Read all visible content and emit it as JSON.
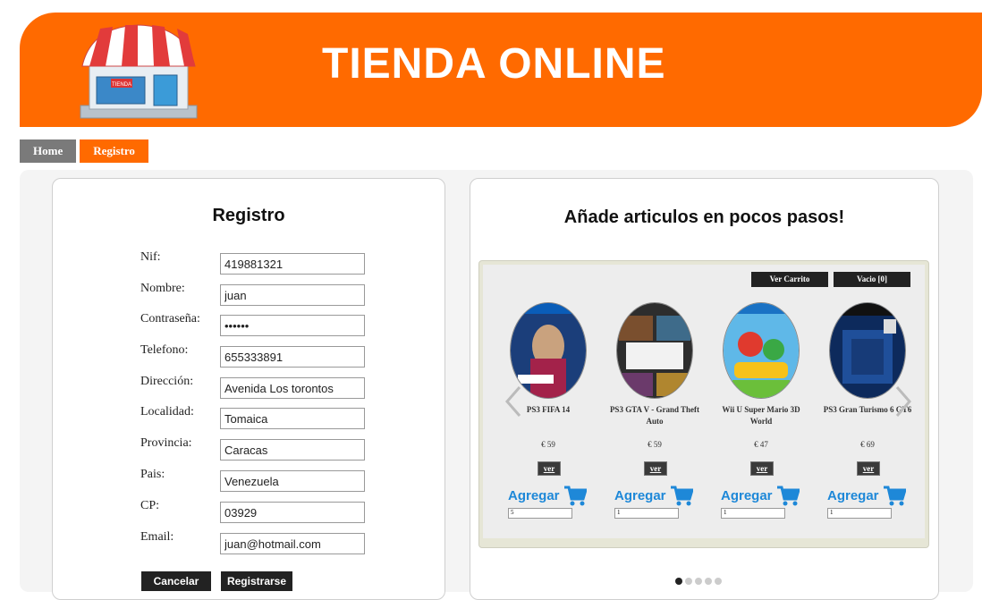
{
  "header": {
    "title": "TIENDA ONLINE",
    "logo_sign": "TIENDA"
  },
  "nav": {
    "home": "Home",
    "registro": "Registro"
  },
  "registro": {
    "title": "Registro",
    "fields": [
      {
        "label": "Nif:",
        "value": "419881321"
      },
      {
        "label": "Nombre:",
        "value": "juan"
      },
      {
        "label": "Contraseña:",
        "value": "••••••"
      },
      {
        "label": "Telefono:",
        "value": "655333891"
      },
      {
        "label": "Dirección:",
        "value": "Avenida Los torontos"
      },
      {
        "label": "Localidad:",
        "value": "Tomaica"
      },
      {
        "label": "Provincia:",
        "value": "Caracas"
      },
      {
        "label": "Pais:",
        "value": "Venezuela"
      },
      {
        "label": "CP:",
        "value": "03929"
      },
      {
        "label": "Email:",
        "value": "juan@hotmail.com"
      }
    ],
    "cancel": "Cancelar",
    "submit": "Registrarse"
  },
  "cart": {
    "title": "Añade articulos en pocos pasos!",
    "ver_carrito": "Ver Carrito",
    "vacio": "Vacio [0]",
    "ver_label": "ver",
    "agregar_label": "Agregar",
    "products": [
      {
        "name": "PS3 FIFA 14",
        "price": "€ 59",
        "qty": "5"
      },
      {
        "name": "PS3 GTA V - Grand Theft Auto",
        "price": "€ 59",
        "qty": "1"
      },
      {
        "name": "Wii U Super Mario 3D World",
        "price": "€ 47",
        "qty": "1"
      },
      {
        "name": "PS3 Gran Turismo 6 GT6",
        "price": "€ 69",
        "qty": "1"
      }
    ],
    "colors": {
      "accent": "#ff6a00",
      "agregar": "#1e88d8"
    }
  }
}
